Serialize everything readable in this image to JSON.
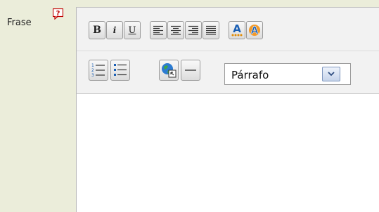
{
  "field": {
    "label": "Frase",
    "help_icon": "help-question-icon"
  },
  "toolbar": {
    "bold_label": "B",
    "italic_label": "i",
    "underline_label": "U",
    "align_left_icon": "align-left-icon",
    "align_center_icon": "align-center-icon",
    "align_right_icon": "align-right-icon",
    "align_justify_icon": "align-justify-icon",
    "text_color_icon": "text-color-icon",
    "highlight_color_icon": "highlight-color-icon",
    "ordered_list_icon": "ordered-list-icon",
    "unordered_list_icon": "unordered-list-icon",
    "link_icon": "insert-link-icon",
    "hr_icon": "horizontal-rule-icon",
    "format_select": {
      "value": "Párrafo"
    }
  },
  "editor": {
    "content": ""
  },
  "colors": {
    "page_bg": "#ebedda",
    "toolbar_bg": "#f2f2f2",
    "editor_bg": "#ffffff"
  }
}
